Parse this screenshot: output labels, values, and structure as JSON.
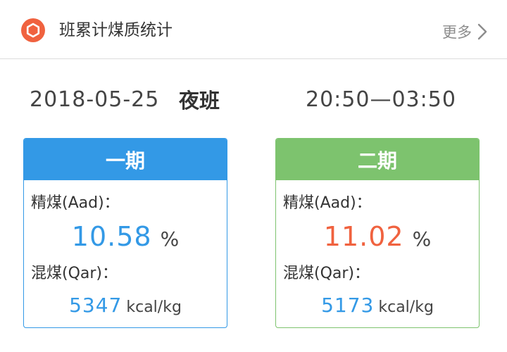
{
  "header": {
    "logo_icon": "hexagon-icon",
    "title": "班累计煤质统计",
    "more_label": "更多",
    "more_icon": "chevron-right-icon"
  },
  "shift": {
    "date": "2018-05-25",
    "name": "夜班",
    "time_range": "20:50—03:50"
  },
  "cards": [
    {
      "title": "一期",
      "accent": "#3399e6",
      "clean_coal_label": "精煤(Aad)：",
      "clean_coal_value": "10.58",
      "clean_coal_unit": "%",
      "mixed_coal_label": "混煤(Qar)：",
      "mixed_coal_value": "5347",
      "mixed_coal_unit": "kcal/kg"
    },
    {
      "title": "二期",
      "accent": "#7dc36e",
      "clean_coal_label": "精煤(Aad)：",
      "clean_coal_value": "11.02",
      "clean_coal_unit": "%",
      "mixed_coal_label": "混煤(Qar)：",
      "mixed_coal_value": "5173",
      "mixed_coal_unit": "kcal/kg"
    }
  ]
}
